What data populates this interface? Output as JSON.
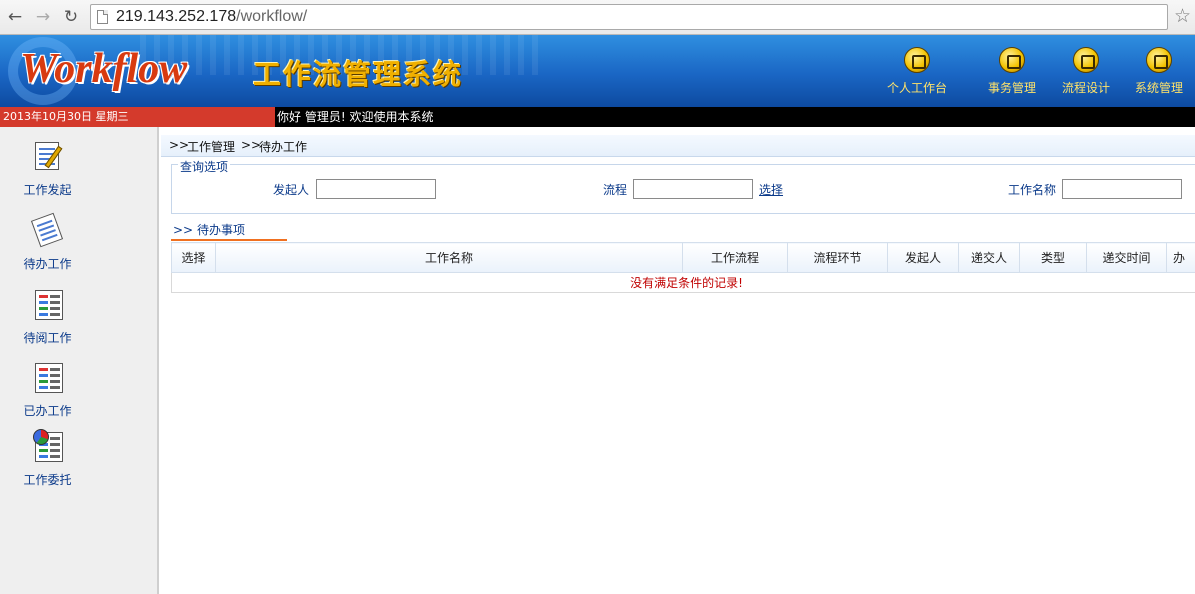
{
  "browser": {
    "url_host": "219.143.252.178",
    "url_path": "/workflow/"
  },
  "header": {
    "logo_en": "Workflow",
    "logo_cn": "工作流管理系统",
    "nav": [
      {
        "label": "个人工作台",
        "icon": "workbench-icon"
      },
      {
        "label": "事务管理",
        "icon": "affairs-icon"
      },
      {
        "label": "流程设计",
        "icon": "flow-design-icon"
      },
      {
        "label": "系统管理",
        "icon": "system-settings-icon"
      }
    ]
  },
  "strip": {
    "date": "2013年10月30日 星期三",
    "welcome": "你好 管理员! 欢迎使用本系统"
  },
  "sidebar": {
    "items": [
      {
        "label": "工作发起",
        "icon": "start-work-icon"
      },
      {
        "label": "待办工作",
        "icon": "todo-work-icon"
      },
      {
        "label": "待阅工作",
        "icon": "to-read-icon"
      },
      {
        "label": "已办工作",
        "icon": "done-work-icon"
      },
      {
        "label": "工作委托",
        "icon": "delegate-icon"
      }
    ]
  },
  "breadcrumb": {
    "sep": ">>",
    "level1": "工作管理",
    "level2": "待办工作"
  },
  "query": {
    "legend": "查询选项",
    "initiator_label": "发起人",
    "initiator_value": "",
    "flow_label": "流程",
    "flow_value": "",
    "select_link": "选择",
    "work_name_label": "工作名称",
    "work_name_value": ""
  },
  "todo": {
    "section_title": "待办事项",
    "columns": [
      "选择",
      "工作名称",
      "工作流程",
      "流程环节",
      "发起人",
      "递交人",
      "类型",
      "递交时间",
      "办"
    ],
    "empty_message": "没有满足条件的记录!"
  },
  "colors": {
    "header_blue": "#1a66c4",
    "date_red": "#d43a2c",
    "link_blue": "#0b3a8a",
    "tab_orange": "#f07020",
    "empty_red": "#c00000"
  }
}
